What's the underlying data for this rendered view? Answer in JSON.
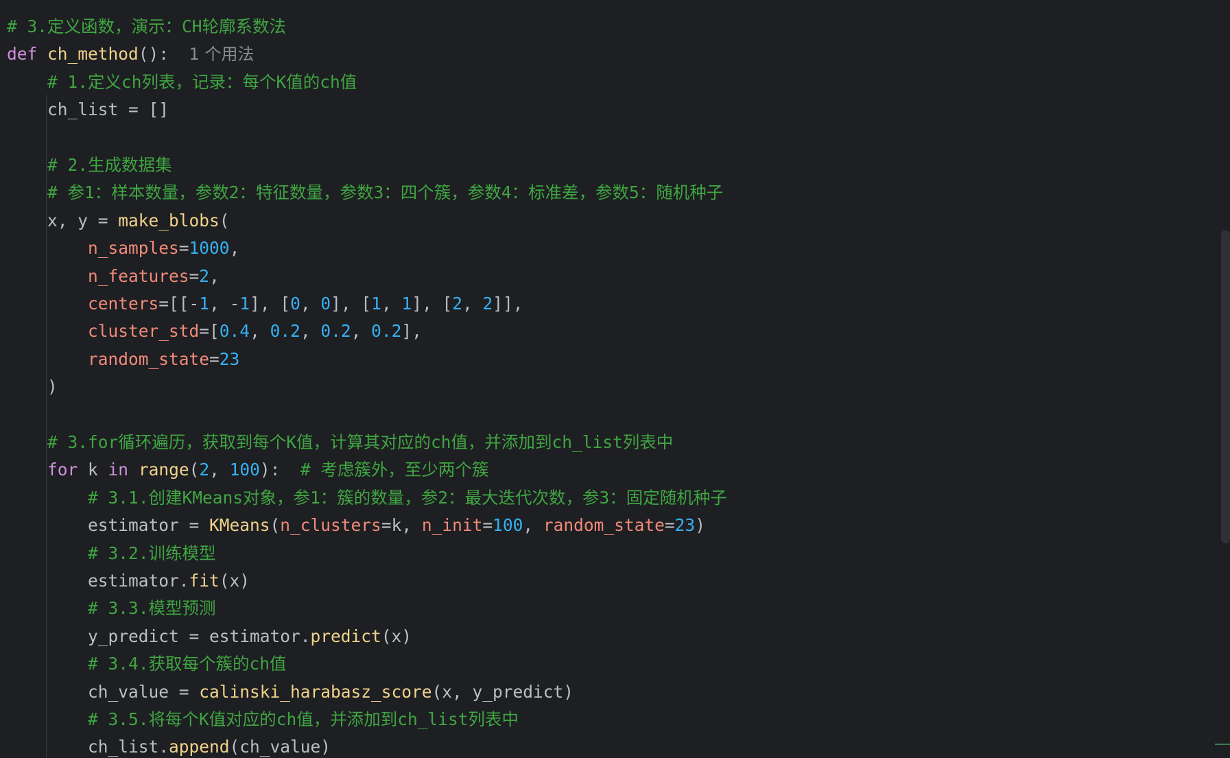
{
  "editor": {
    "lines": [
      [
        {
          "t": "c",
          "v": "# 3.定义函数，演示：CH轮廓系数法"
        }
      ],
      [
        {
          "t": "k",
          "v": "def "
        },
        {
          "t": "f",
          "v": "ch_method"
        },
        {
          "t": "d",
          "v": "():  "
        },
        {
          "t": "h",
          "v": "1 个用法"
        }
      ],
      [
        {
          "t": "d",
          "v": "    "
        },
        {
          "t": "c",
          "v": "# 1.定义ch列表，记录：每个K值的ch值"
        }
      ],
      [
        {
          "t": "d",
          "v": "    ch_list = []"
        }
      ],
      [],
      [
        {
          "t": "d",
          "v": "    "
        },
        {
          "t": "c",
          "v": "# 2.生成数据集"
        }
      ],
      [
        {
          "t": "d",
          "v": "    "
        },
        {
          "t": "c",
          "v": "# 参1：样本数量，参数2：特征数量，参数3：四个簇，参数4：标准差，参数5：随机种子"
        }
      ],
      [
        {
          "t": "d",
          "v": "    x, y = "
        },
        {
          "t": "f",
          "v": "make_blobs"
        },
        {
          "t": "d",
          "v": "("
        }
      ],
      [
        {
          "t": "d",
          "v": "        "
        },
        {
          "t": "p",
          "v": "n_samples"
        },
        {
          "t": "d",
          "v": "="
        },
        {
          "t": "n",
          "v": "1000"
        },
        {
          "t": "d",
          "v": ","
        }
      ],
      [
        {
          "t": "d",
          "v": "        "
        },
        {
          "t": "p",
          "v": "n_features"
        },
        {
          "t": "d",
          "v": "="
        },
        {
          "t": "n",
          "v": "2"
        },
        {
          "t": "d",
          "v": ","
        }
      ],
      [
        {
          "t": "d",
          "v": "        "
        },
        {
          "t": "p",
          "v": "centers"
        },
        {
          "t": "d",
          "v": "=[[-"
        },
        {
          "t": "n",
          "v": "1"
        },
        {
          "t": "d",
          "v": ", -"
        },
        {
          "t": "n",
          "v": "1"
        },
        {
          "t": "d",
          "v": "], ["
        },
        {
          "t": "n",
          "v": "0"
        },
        {
          "t": "d",
          "v": ", "
        },
        {
          "t": "n",
          "v": "0"
        },
        {
          "t": "d",
          "v": "], ["
        },
        {
          "t": "n",
          "v": "1"
        },
        {
          "t": "d",
          "v": ", "
        },
        {
          "t": "n",
          "v": "1"
        },
        {
          "t": "d",
          "v": "], ["
        },
        {
          "t": "n",
          "v": "2"
        },
        {
          "t": "d",
          "v": ", "
        },
        {
          "t": "n",
          "v": "2"
        },
        {
          "t": "d",
          "v": "]],"
        }
      ],
      [
        {
          "t": "d",
          "v": "        "
        },
        {
          "t": "p",
          "v": "cluster_std"
        },
        {
          "t": "d",
          "v": "=["
        },
        {
          "t": "n",
          "v": "0.4"
        },
        {
          "t": "d",
          "v": ", "
        },
        {
          "t": "n",
          "v": "0.2"
        },
        {
          "t": "d",
          "v": ", "
        },
        {
          "t": "n",
          "v": "0.2"
        },
        {
          "t": "d",
          "v": ", "
        },
        {
          "t": "n",
          "v": "0.2"
        },
        {
          "t": "d",
          "v": "],"
        }
      ],
      [
        {
          "t": "d",
          "v": "        "
        },
        {
          "t": "p",
          "v": "random_state"
        },
        {
          "t": "d",
          "v": "="
        },
        {
          "t": "n",
          "v": "23"
        }
      ],
      [
        {
          "t": "d",
          "v": "    )"
        }
      ],
      [],
      [
        {
          "t": "d",
          "v": "    "
        },
        {
          "t": "c",
          "v": "# 3.for循环遍历，获取到每个K值，计算其对应的ch值，并添加到ch_list列表中"
        }
      ],
      [
        {
          "t": "d",
          "v": "    "
        },
        {
          "t": "k",
          "v": "for"
        },
        {
          "t": "d",
          "v": " k "
        },
        {
          "t": "k",
          "v": "in"
        },
        {
          "t": "d",
          "v": " "
        },
        {
          "t": "f",
          "v": "range"
        },
        {
          "t": "d",
          "v": "("
        },
        {
          "t": "n",
          "v": "2"
        },
        {
          "t": "d",
          "v": ", "
        },
        {
          "t": "n",
          "v": "100"
        },
        {
          "t": "d",
          "v": "):  "
        },
        {
          "t": "c",
          "v": "# 考虑簇外，至少两个簇"
        }
      ],
      [
        {
          "t": "d",
          "v": "        "
        },
        {
          "t": "c",
          "v": "# 3.1.创建KMeans对象，参1：簇的数量，参2：最大迭代次数，参3：固定随机种子"
        }
      ],
      [
        {
          "t": "d",
          "v": "        estimator = "
        },
        {
          "t": "f",
          "v": "KMeans"
        },
        {
          "t": "d",
          "v": "("
        },
        {
          "t": "p",
          "v": "n_clusters"
        },
        {
          "t": "d",
          "v": "=k, "
        },
        {
          "t": "p",
          "v": "n_init"
        },
        {
          "t": "d",
          "v": "="
        },
        {
          "t": "n",
          "v": "100"
        },
        {
          "t": "d",
          "v": ", "
        },
        {
          "t": "p",
          "v": "random_state"
        },
        {
          "t": "d",
          "v": "="
        },
        {
          "t": "n",
          "v": "23"
        },
        {
          "t": "d",
          "v": ")"
        }
      ],
      [
        {
          "t": "d",
          "v": "        "
        },
        {
          "t": "c",
          "v": "# 3.2.训练模型"
        }
      ],
      [
        {
          "t": "d",
          "v": "        estimator."
        },
        {
          "t": "f",
          "v": "fit"
        },
        {
          "t": "d",
          "v": "(x)"
        }
      ],
      [
        {
          "t": "d",
          "v": "        "
        },
        {
          "t": "c",
          "v": "# 3.3.模型预测"
        }
      ],
      [
        {
          "t": "d",
          "v": "        y_predict = estimator."
        },
        {
          "t": "f",
          "v": "predict"
        },
        {
          "t": "d",
          "v": "(x)"
        }
      ],
      [
        {
          "t": "d",
          "v": "        "
        },
        {
          "t": "c",
          "v": "# 3.4.获取每个簇的ch值"
        }
      ],
      [
        {
          "t": "d",
          "v": "        ch_value = "
        },
        {
          "t": "f",
          "v": "calinski_harabasz_score"
        },
        {
          "t": "d",
          "v": "(x, y_predict)"
        }
      ],
      [
        {
          "t": "d",
          "v": "        "
        },
        {
          "t": "c",
          "v": "# 3.5.将每个K值对应的ch值，并添加到ch_list列表中"
        }
      ],
      [
        {
          "t": "d",
          "v": "        ch_list."
        },
        {
          "t": "f",
          "v": "append"
        },
        {
          "t": "d",
          "v": "(ch_value)"
        }
      ]
    ]
  },
  "colors": {
    "background": "#1e1f22",
    "default": "#bcbec4",
    "comment": "#3fa542",
    "keyword": "#cf8ee0",
    "function": "#f0d28a",
    "parameter": "#f08a7a",
    "number": "#35b1f2",
    "hint": "#8a8d93"
  }
}
